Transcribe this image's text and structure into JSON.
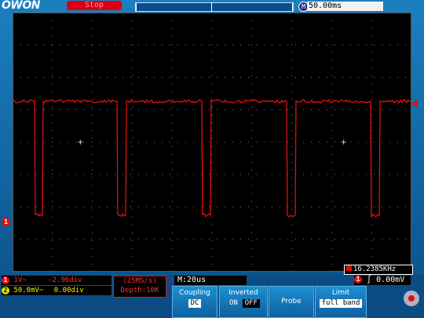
{
  "header": {
    "logo": "OWON",
    "run_state": "Stop",
    "timebase_icon": "M",
    "timebase": "50.00ms"
  },
  "markers": {
    "ch1_ground": "1"
  },
  "frequency": {
    "value": "16.2385KHz"
  },
  "channels": {
    "ch1": {
      "badge": "1",
      "scale": "1V~",
      "offset": "-2.96div"
    },
    "ch2": {
      "badge": "2",
      "scale": "50.0mV~",
      "offset": "0.00div"
    }
  },
  "acquisition": {
    "sample_rate": "(25MS/s)",
    "depth": "Depth:10K"
  },
  "main_time": "M:20us",
  "trigger": {
    "badge": "1",
    "symbol": "∫",
    "level": "0.00mV"
  },
  "menu": {
    "coupling": {
      "title": "Coupling",
      "value": "DC"
    },
    "inverted": {
      "title": "Inverted",
      "on": "ON",
      "off": "OFF"
    },
    "probe": {
      "title": "Probe"
    },
    "limit": {
      "title": "Limit",
      "value": "full band"
    }
  },
  "colors": {
    "trace": "#e01010",
    "background": "#000000",
    "frame": "#0d5a8f"
  }
}
